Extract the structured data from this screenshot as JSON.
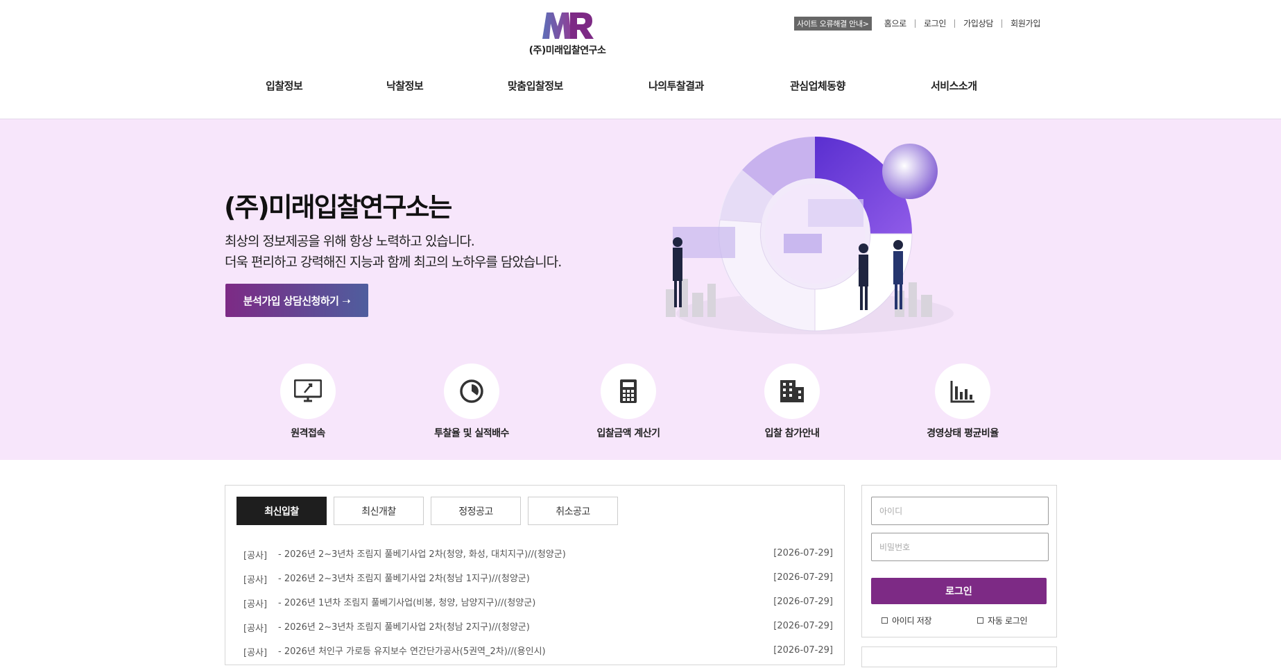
{
  "header": {
    "logo_name": "(주)미래입찰연구소",
    "site_notice": "사이트 오류해결 안내>",
    "top_links": [
      "홈으로",
      "로그인",
      "가입상담",
      "회원가입"
    ],
    "nav": [
      "입찰정보",
      "낙찰정보",
      "맞춤입찰정보",
      "나의투찰결과",
      "관심업체동향",
      "서비스소개"
    ]
  },
  "hero": {
    "title": "(주)미래입찰연구소는",
    "line1": "최상의 정보제공을 위해 항상 노력하고 있습니다.",
    "line2": "더욱 편리하고 강력해진 지능과 함께 최고의 노하우를 담았습니다.",
    "cta": "분석가입 상담신청하기 ➝"
  },
  "quick_menu": [
    {
      "label": "원격접속",
      "icon": "remote-monitor-icon"
    },
    {
      "label": "투찰율 및 실적배수",
      "icon": "pie-chart-icon"
    },
    {
      "label": "입찰금액 계산기",
      "icon": "calculator-icon"
    },
    {
      "label": "입찰 참가안내",
      "icon": "building-icon"
    },
    {
      "label": "경영상태 평균비율",
      "icon": "bar-chart-icon"
    }
  ],
  "board": {
    "tabs": [
      "최신입찰",
      "최신개찰",
      "정정공고",
      "취소공고"
    ],
    "active_tab": "최신입찰",
    "rows": [
      {
        "type": "[공사]",
        "title": "- 2026년 2~3년차 조림지 풀베기사업 2차(청양, 화성, 대치지구)//(청양군)",
        "date": "[2026-07-29]"
      },
      {
        "type": "[공사]",
        "title": "- 2026년 2~3년차 조림지 풀베기사업 2차(청남 1지구)//(청양군)",
        "date": "[2026-07-29]"
      },
      {
        "type": "[공사]",
        "title": "- 2026년 1년차 조림지 풀베기사업(비봉, 청양, 남양지구)//(청양군)",
        "date": "[2026-07-29]"
      },
      {
        "type": "[공사]",
        "title": "- 2026년 2~3년차 조림지 풀베기사업 2차(청남 2지구)//(청양군)",
        "date": "[2026-07-29]"
      },
      {
        "type": "[공사]",
        "title": "- 2026년 처인구 가로등 유지보수 연간단가공사(5권역_2차)//(용인시)",
        "date": "[2026-07-29]"
      }
    ]
  },
  "login": {
    "id_placeholder": "아이디",
    "pw_placeholder": "비밀번호",
    "button": "로그인",
    "save_id": "아이디 저장",
    "auto_login": "자동 로그인"
  },
  "colors": {
    "brand_purple": "#7d2a85",
    "hero_bg": "#f7e6fb",
    "tab_active": "#1e1e1e"
  }
}
